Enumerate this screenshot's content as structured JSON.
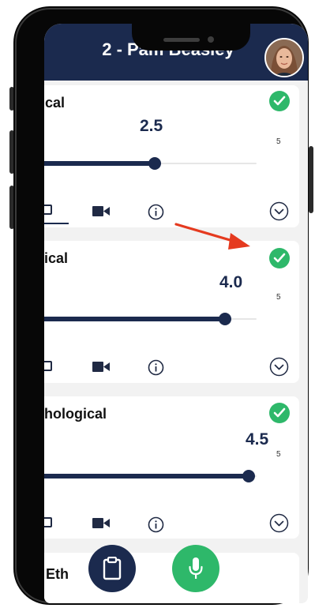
{
  "header": {
    "title": "2 - Pam Beasley"
  },
  "cards": [
    {
      "title": "ctical",
      "score": "2.5",
      "max": "5",
      "value": 2.5
    },
    {
      "title": "ysical",
      "score": "4.0",
      "max": "5",
      "value": 4.0
    },
    {
      "title": "ychological",
      "score": "4.5",
      "max": "5",
      "value": 4.5
    },
    {
      "title": "rk Eth"
    }
  ],
  "icons": {
    "avatar": "user-avatar",
    "check": "check-icon",
    "video": "video-camera-icon",
    "info": "info-icon",
    "expand": "chevron-down-circle-icon",
    "notes": "clipboard-icon",
    "mic": "microphone-icon"
  },
  "colors": {
    "header": "#1b2a4e",
    "accent_green": "#2eb86a",
    "annotation_arrow": "#e53a1f"
  }
}
